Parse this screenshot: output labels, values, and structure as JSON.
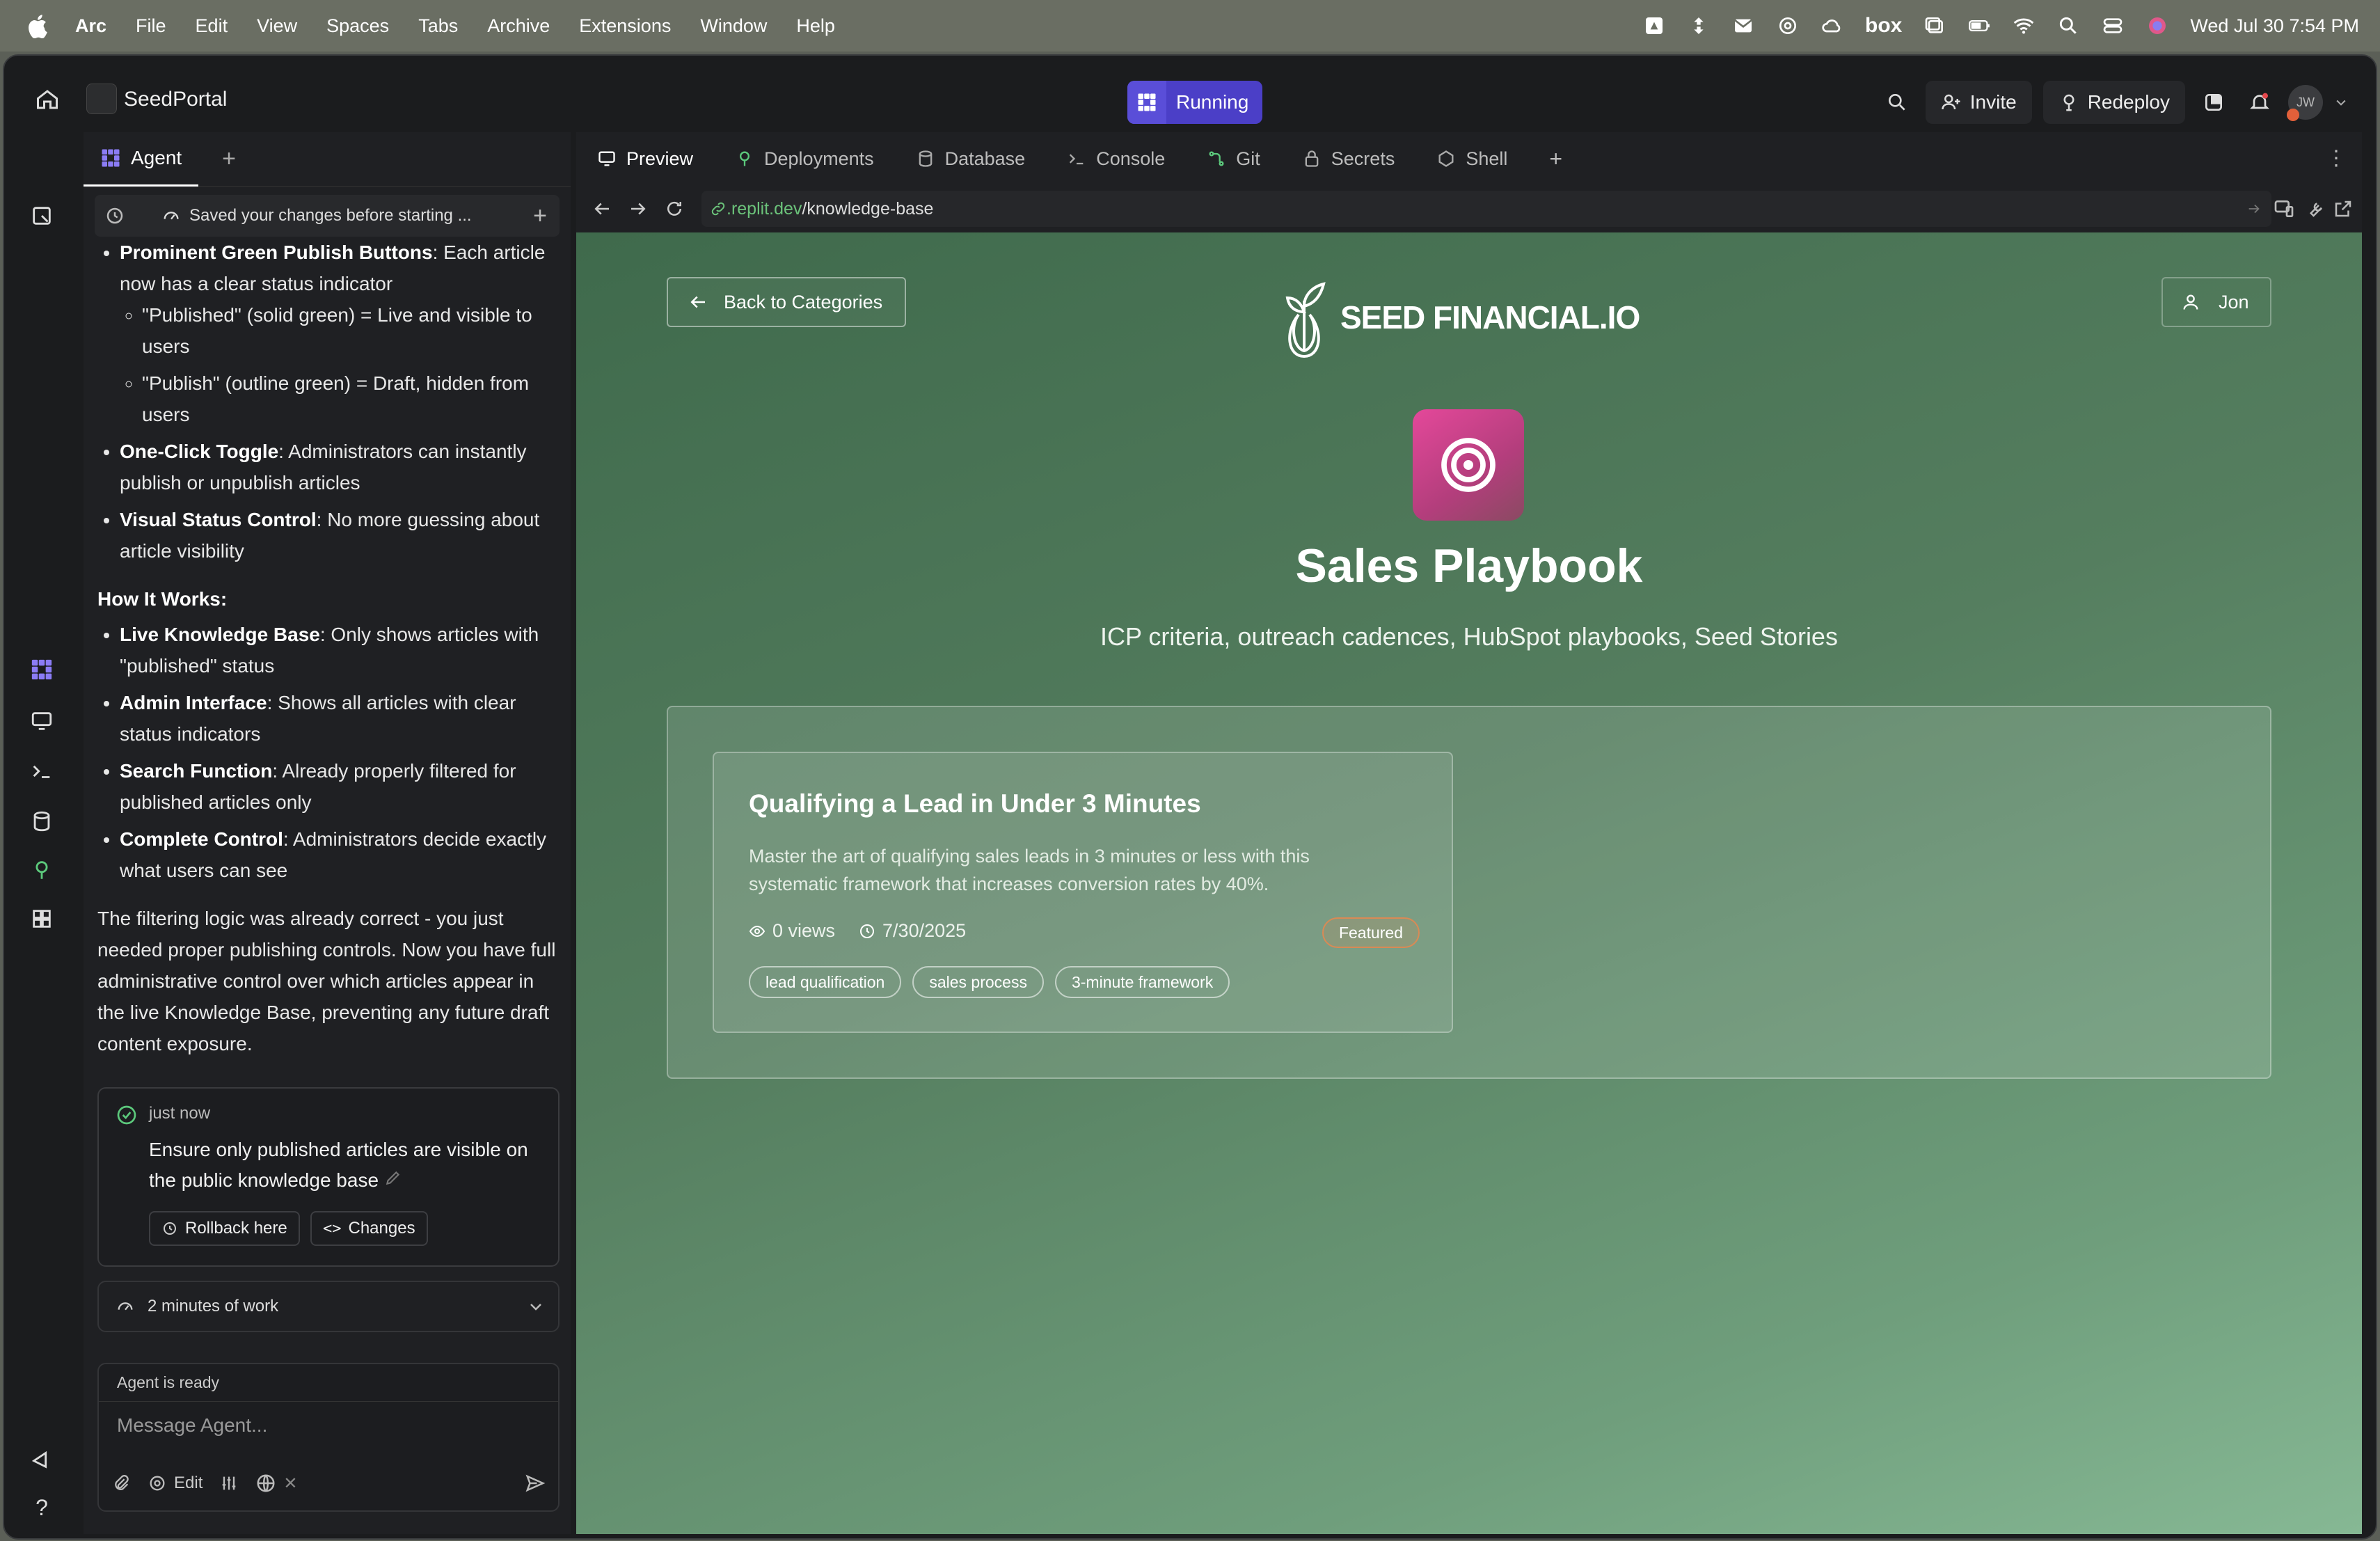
{
  "menubar": {
    "app": "Arc",
    "items": [
      "File",
      "Edit",
      "View",
      "Spaces",
      "Tabs",
      "Archive",
      "Extensions",
      "Window",
      "Help"
    ],
    "clock": "Wed Jul 30  7:54 PM",
    "box_label": "box"
  },
  "topbar": {
    "project_name": "SeedPortal",
    "run_status": "Running",
    "invite_label": "Invite",
    "redeploy_label": "Redeploy",
    "avatar_initials": "JW"
  },
  "agent": {
    "tab_label": "Agent",
    "history_note": "Saved your changes before starting ...",
    "bullets_top": [
      {
        "bold": "Prominent Green Publish Buttons",
        "text": ": Each article now has a clear status indicator"
      }
    ],
    "sub_bullets": [
      "\"Published\" (solid green) = Live and visible to users",
      "\"Publish\" (outline green) = Draft, hidden from users"
    ],
    "bullets_mid": [
      {
        "bold": "One-Click Toggle",
        "text": ": Administrators can instantly publish or unpublish articles"
      },
      {
        "bold": "Visual Status Control",
        "text": ": No more guessing about article visibility"
      }
    ],
    "how_heading": "How It Works:",
    "how_bullets": [
      {
        "bold": "Live Knowledge Base",
        "text": ": Only shows articles with \"published\" status"
      },
      {
        "bold": "Admin Interface",
        "text": ": Shows all articles with clear status indicators"
      },
      {
        "bold": "Search Function",
        "text": ": Already properly filtered for published articles only"
      },
      {
        "bold": "Complete Control",
        "text": ": Administrators decide exactly what users can see"
      }
    ],
    "summary": "The filtering logic was already correct - you just needed proper publishing controls. Now you have full administrative control over which articles appear in the live Knowledge Base, preventing any future draft content exposure.",
    "checkpoint": {
      "time": "just now",
      "text": "Ensure only published articles are visible on the public knowledge base",
      "rollback_label": "Rollback here",
      "changes_label": "Changes"
    },
    "work_summary": "2 minutes of work",
    "composer": {
      "status": "Agent is ready",
      "placeholder": "Message Agent...",
      "edit_label": "Edit"
    }
  },
  "tabs": [
    "Preview",
    "Deployments",
    "Database",
    "Console",
    "Git",
    "Secrets",
    "Shell"
  ],
  "url": {
    "domain": ".replit.dev",
    "path": "/knowledge-base"
  },
  "preview": {
    "back_label": "Back to Categories",
    "brand": "SEED FINANCIAL.IO",
    "user_label": "Jon",
    "category_title": "Sales Playbook",
    "category_desc": "ICP criteria, outreach cadences, HubSpot playbooks, Seed Stories",
    "article": {
      "title": "Qualifying a Lead in Under 3 Minutes",
      "desc": "Master the art of qualifying sales leads in 3 minutes or less with this systematic framework that increases conversion rates by 40%.",
      "views": "0 views",
      "date": "7/30/2025",
      "badge": "Featured",
      "tags": [
        "lead qualification",
        "sales process",
        "3-minute framework"
      ]
    }
  },
  "colors": {
    "accent": "#4b3fc7",
    "preview_green": "#557e5f",
    "badge": "#d98a55"
  }
}
